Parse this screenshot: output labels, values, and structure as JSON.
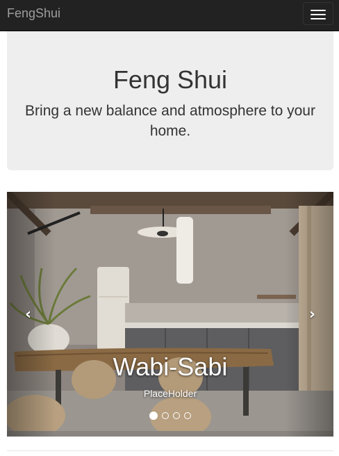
{
  "navbar": {
    "brand": "FengShui",
    "toggle_icon": "hamburger-menu-icon"
  },
  "jumbotron": {
    "title": "Feng Shui",
    "subtitle": "Bring a new balance and atmosphere to your home."
  },
  "carousel": {
    "slide_image": "Wabi-Sabi kitchen interior photo",
    "caption_title": "Wabi-Sabi",
    "caption_text": "PlaceHolder",
    "prev_icon": "chevron-left-icon",
    "next_icon": "chevron-right-icon",
    "prev_glyph": "‹",
    "next_glyph": "›",
    "slide_count": 4,
    "active_index": 0
  }
}
